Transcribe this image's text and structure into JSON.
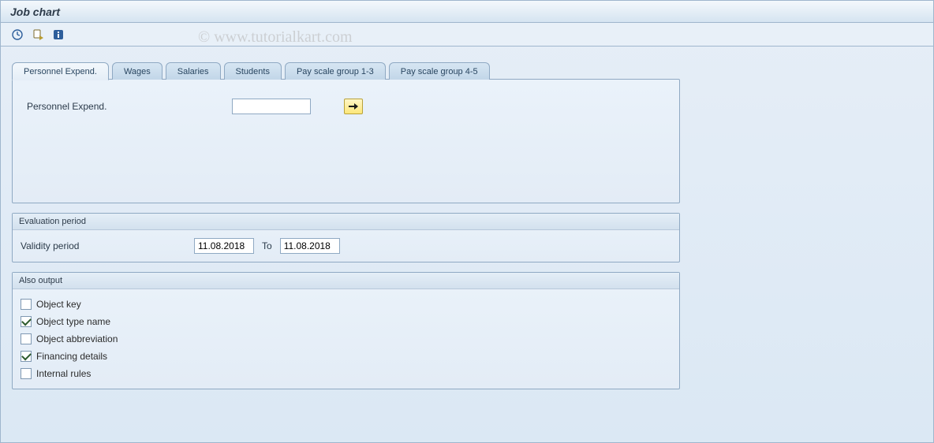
{
  "title": "Job chart",
  "watermark": "© www.tutorialkart.com",
  "toolbar": {
    "execute_title": "Execute",
    "variant_title": "Get Variant",
    "help_title": "Program Documentation"
  },
  "tabs": [
    {
      "label": "Personnel Expend.",
      "active": true
    },
    {
      "label": "Wages",
      "active": false
    },
    {
      "label": "Salaries",
      "active": false
    },
    {
      "label": "Students",
      "active": false
    },
    {
      "label": "Pay scale group 1-3",
      "active": false
    },
    {
      "label": "Pay scale group 4-5",
      "active": false
    }
  ],
  "tab_panel": {
    "field_label": "Personnel Expend.",
    "field_value": "",
    "arrow_title": "Multiple selection"
  },
  "evaluation": {
    "header": "Evaluation period",
    "validity_label": "Validity period",
    "from": "11.08.2018",
    "to_label": "To",
    "to": "11.08.2018"
  },
  "output": {
    "header": "Also output",
    "items": [
      {
        "label": "Object key",
        "checked": false
      },
      {
        "label": "Object type name",
        "checked": true
      },
      {
        "label": "Object abbreviation",
        "checked": false
      },
      {
        "label": "Financing details",
        "checked": true
      },
      {
        "label": "Internal rules",
        "checked": false
      }
    ]
  }
}
